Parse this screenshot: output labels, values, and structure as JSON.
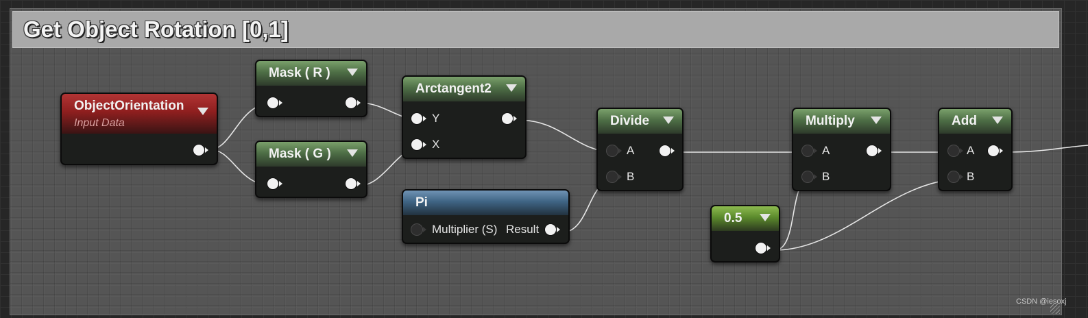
{
  "comment": {
    "title": "Get Object Rotation [0,1]"
  },
  "nodes": {
    "object_orientation": {
      "title": "ObjectOrientation",
      "subtitle": "Input Data"
    },
    "mask_r": {
      "title": "Mask ( R )"
    },
    "mask_g": {
      "title": "Mask ( G )"
    },
    "arctangent2": {
      "title": "Arctangent2",
      "pins": {
        "y": "Y",
        "x": "X"
      }
    },
    "pi": {
      "title": "Pi",
      "pins": {
        "multiplier": "Multiplier (S)",
        "result": "Result"
      }
    },
    "divide": {
      "title": "Divide",
      "pins": {
        "a": "A",
        "b": "B"
      }
    },
    "constant": {
      "title": "0.5"
    },
    "multiply": {
      "title": "Multiply",
      "pins": {
        "a": "A",
        "b": "B"
      }
    },
    "add": {
      "title": "Add",
      "pins": {
        "a": "A",
        "b": "B"
      }
    }
  },
  "watermark": "CSDN @iesoxj",
  "colors": {
    "material_header_green": "#4e6f46",
    "input_header_red": "#8e1f1f",
    "constant_header_blue": "#3f6484",
    "wire": "#e6e6e6"
  }
}
